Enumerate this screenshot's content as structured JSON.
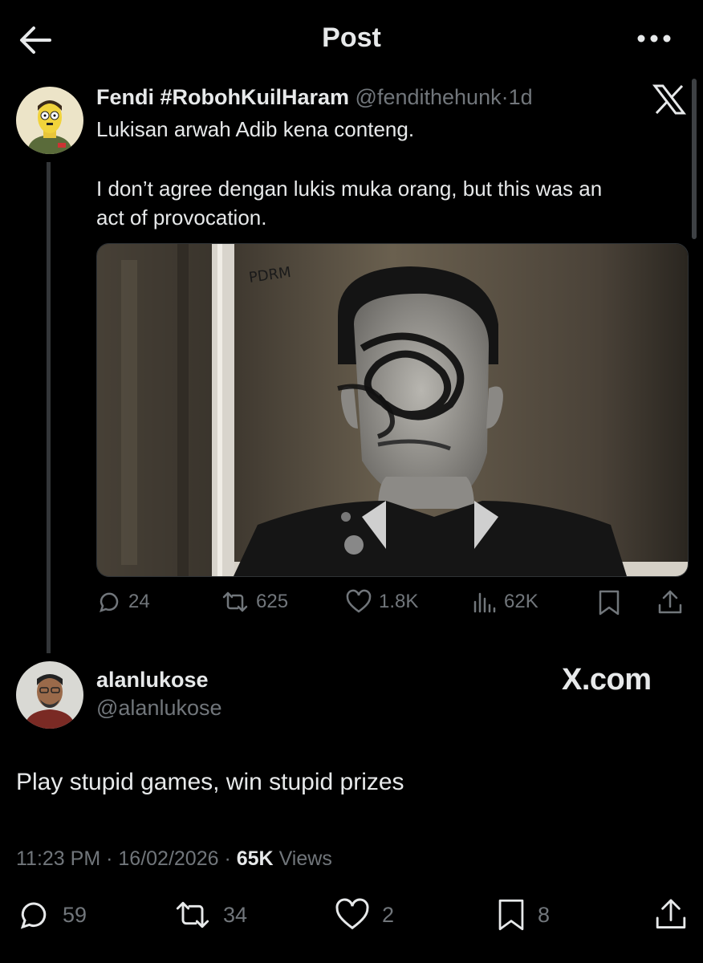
{
  "header": {
    "title": "Post"
  },
  "quoted": {
    "display_name": "Fendi #RobohKuilHaram",
    "handle": "@fendithehunk",
    "separator": "·",
    "time": "1d",
    "text_line1": "Lukisan arwah Adib kena conteng.",
    "text_line2": "I don’t agree dengan lukis muka orang, but this was an",
    "text_line3": "act of provocation.",
    "media_text": "PDRM",
    "actions": {
      "replies": "24",
      "reposts": "625",
      "likes": "1.8K",
      "views": "62K"
    }
  },
  "post": {
    "display_name": "alanlukose",
    "handle": "@alanlukose",
    "watermark": "X.com",
    "text": "Play stupid games, win stupid prizes",
    "time": "11:23 PM",
    "sep1": "·",
    "date": "16/02/2026",
    "sep2": "·",
    "views_count": "65K",
    "views_label": "Views",
    "actions": {
      "replies": "59",
      "reposts": "34",
      "likes": "2",
      "bookmarks": "8"
    }
  },
  "icons": {
    "back": "arrow-left-icon",
    "more": "more-horizontal-icon",
    "x_logo": "x-logo-icon",
    "reply": "reply-icon",
    "repost": "repost-icon",
    "like": "heart-icon",
    "views": "views-icon",
    "bookmark": "bookmark-icon",
    "share": "share-icon"
  }
}
